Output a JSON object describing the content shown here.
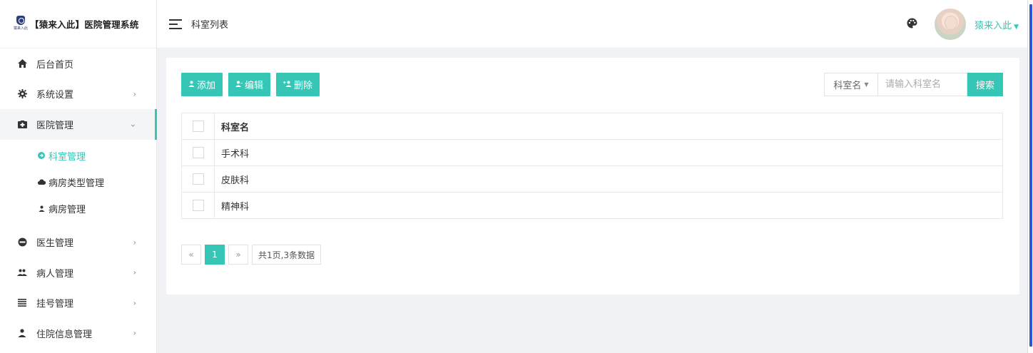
{
  "app": {
    "logo_small_text": "猿来入此",
    "title": "【猿来入此】医院管理系统"
  },
  "header": {
    "page_title": "科室列表",
    "username": "猿来入此"
  },
  "sidebar": {
    "items": [
      {
        "label": "后台首页",
        "icon": "home-icon"
      },
      {
        "label": "系统设置",
        "icon": "gear-icon"
      },
      {
        "label": "医院管理",
        "icon": "hospital-icon"
      },
      {
        "label": "医生管理",
        "icon": "doctor-icon"
      },
      {
        "label": "病人管理",
        "icon": "people-icon"
      },
      {
        "label": "挂号管理",
        "icon": "list-icon"
      },
      {
        "label": "住院信息管理",
        "icon": "person-icon"
      }
    ],
    "submenu": [
      {
        "label": "科室管理",
        "icon": "circle-arrow-icon",
        "active": true
      },
      {
        "label": "病房类型管理",
        "icon": "cloud-icon"
      },
      {
        "label": "病房管理",
        "icon": "user-icon"
      }
    ]
  },
  "toolbar": {
    "add_label": "添加",
    "edit_label": "编辑",
    "delete_label": "删除"
  },
  "search": {
    "field_label": "科室名",
    "placeholder": "请输入科室名",
    "button_label": "搜索"
  },
  "table": {
    "columns": [
      "科室名"
    ],
    "rows": [
      {
        "name": "手术科"
      },
      {
        "name": "皮肤科"
      },
      {
        "name": "精神科"
      }
    ]
  },
  "pagination": {
    "prev": "«",
    "current_page": "1",
    "next": "»",
    "summary": "共1页,3条数据"
  },
  "colors": {
    "accent": "#36c6b5",
    "scrollbar": "#2b57d8"
  }
}
